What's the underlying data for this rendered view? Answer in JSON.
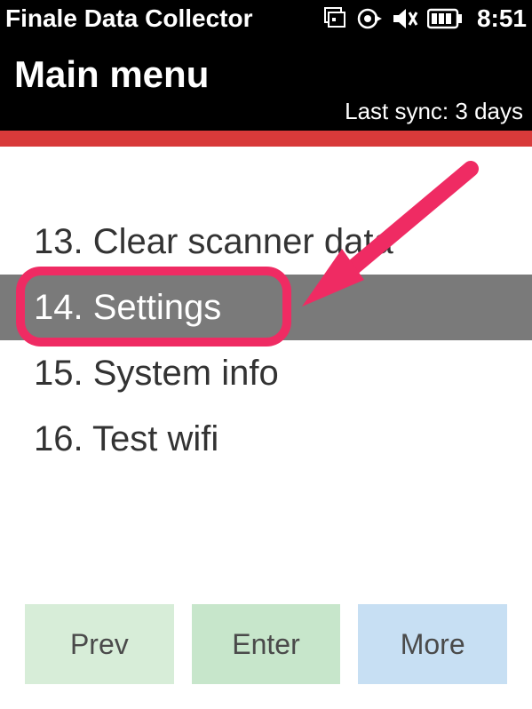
{
  "statusbar": {
    "app_title": "Finale Data Collector",
    "time": "8:51",
    "icons": {
      "windows": "windows-icon",
      "sync": "sync-icon",
      "volume": "volume-icon",
      "battery": "battery-icon"
    }
  },
  "header": {
    "title": "Main menu",
    "last_sync": "Last sync: 3 days"
  },
  "menu": {
    "items": [
      {
        "num": "13.",
        "label": "Clear scanner data",
        "selected": false
      },
      {
        "num": "14.",
        "label": "Settings",
        "selected": true
      },
      {
        "num": "15.",
        "label": "System info",
        "selected": false
      },
      {
        "num": "16.",
        "label": "Test wifi",
        "selected": false
      }
    ]
  },
  "footer": {
    "prev": "Prev",
    "enter": "Enter",
    "more": "More"
  },
  "annotation": {
    "highlight_color": "#ef2b63"
  }
}
